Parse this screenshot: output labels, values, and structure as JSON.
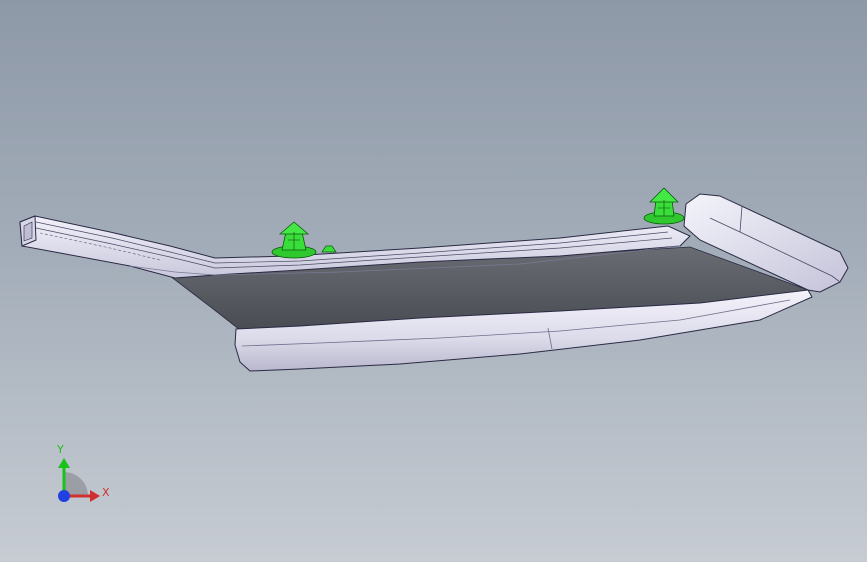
{
  "viewport": {
    "background_top": "#8e99a8",
    "background_bottom": "#c7ccd3"
  },
  "model": {
    "body_color": "#ecebf6",
    "edge_color": "#2a2a44",
    "shadow_face_color": "#54565e",
    "clip_color": "#33dd33"
  },
  "triad": {
    "x_label": "X",
    "y_label": "Y",
    "x_color": "#d03030",
    "y_color": "#19c219",
    "z_color": "#2040e0"
  }
}
